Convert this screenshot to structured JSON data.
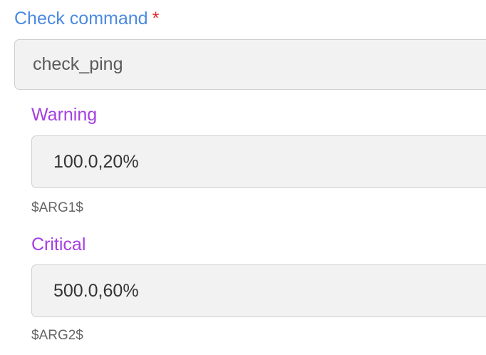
{
  "check_command": {
    "label": "Check command",
    "required_mark": "*",
    "value": "check_ping"
  },
  "arguments": [
    {
      "label": "Warning",
      "value": "100.0,20%",
      "hint": "$ARG1$"
    },
    {
      "label": "Critical",
      "value": "500.0,60%",
      "hint": "$ARG2$"
    }
  ],
  "colors": {
    "main_label": "#4a8ae0",
    "required_mark": "#e02b2b",
    "sub_label": "#a53ee0",
    "input_background": "#f2f2f2",
    "input_border": "#cfcfcf",
    "hint_text": "#666666"
  }
}
